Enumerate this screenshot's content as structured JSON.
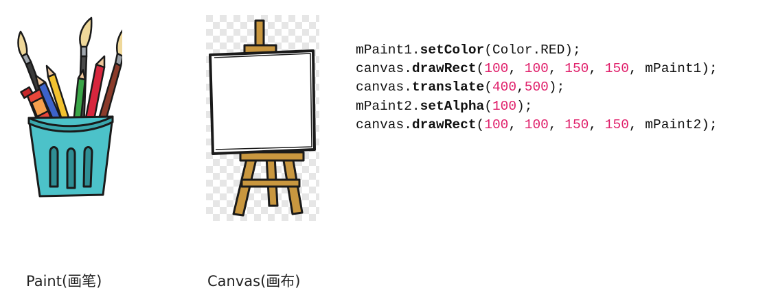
{
  "captions": {
    "paint": "Paint(画笔)",
    "canvas": "Canvas(画布)"
  },
  "code_lines": [
    [
      {
        "type": "plain",
        "text": "mPaint1."
      },
      {
        "type": "method",
        "text": "setColor"
      },
      {
        "type": "plain",
        "text": "(Color.RED);"
      }
    ],
    [
      {
        "type": "plain",
        "text": "canvas."
      },
      {
        "type": "method",
        "text": "drawRect"
      },
      {
        "type": "plain",
        "text": "("
      },
      {
        "type": "num",
        "text": "100"
      },
      {
        "type": "plain",
        "text": ", "
      },
      {
        "type": "num",
        "text": "100"
      },
      {
        "type": "plain",
        "text": ", "
      },
      {
        "type": "num",
        "text": "150"
      },
      {
        "type": "plain",
        "text": ", "
      },
      {
        "type": "num",
        "text": "150"
      },
      {
        "type": "plain",
        "text": ", mPaint1);"
      }
    ],
    [
      {
        "type": "plain",
        "text": "canvas."
      },
      {
        "type": "method",
        "text": "translate"
      },
      {
        "type": "plain",
        "text": "("
      },
      {
        "type": "num",
        "text": "400"
      },
      {
        "type": "plain",
        "text": ","
      },
      {
        "type": "num",
        "text": "500"
      },
      {
        "type": "plain",
        "text": ");"
      }
    ],
    [
      {
        "type": "plain",
        "text": "mPaint2."
      },
      {
        "type": "method",
        "text": "setAlpha"
      },
      {
        "type": "plain",
        "text": "("
      },
      {
        "type": "num",
        "text": "100"
      },
      {
        "type": "plain",
        "text": ");"
      }
    ],
    [
      {
        "type": "plain",
        "text": "canvas."
      },
      {
        "type": "method",
        "text": "drawRect"
      },
      {
        "type": "plain",
        "text": "("
      },
      {
        "type": "num",
        "text": "100"
      },
      {
        "type": "plain",
        "text": ", "
      },
      {
        "type": "num",
        "text": "100"
      },
      {
        "type": "plain",
        "text": ", "
      },
      {
        "type": "num",
        "text": "150"
      },
      {
        "type": "plain",
        "text": ", "
      },
      {
        "type": "num",
        "text": "150"
      },
      {
        "type": "plain",
        "text": ", mPaint2);"
      }
    ]
  ],
  "colors": {
    "number_literal": "#e0206b",
    "code_text": "#111111",
    "cup": "#4cc2c9",
    "easel_wood": "#c9973f"
  },
  "icons": {
    "paint": "paint-brushes-cup-icon",
    "canvas": "easel-canvas-icon"
  }
}
